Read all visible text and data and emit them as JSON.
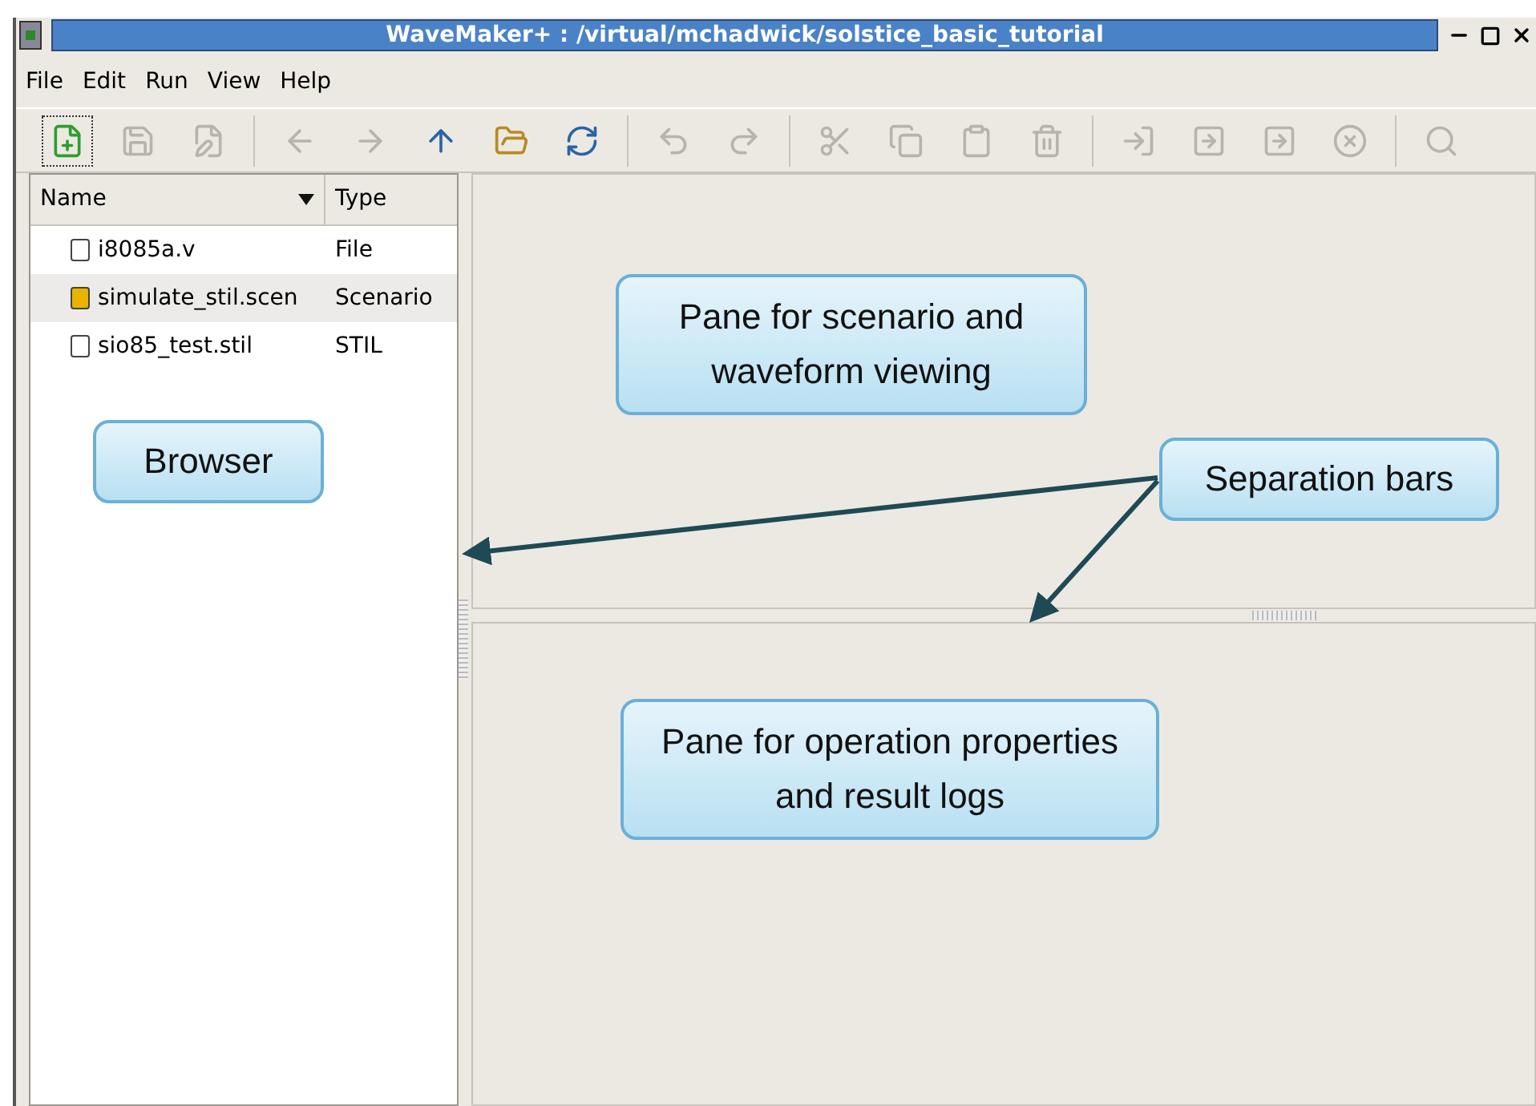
{
  "window": {
    "title": "WaveMaker+ : /virtual/mchadwick/solstice_basic_tutorial"
  },
  "menu": [
    {
      "label": "File"
    },
    {
      "label": "Edit"
    },
    {
      "label": "Run"
    },
    {
      "label": "View"
    },
    {
      "label": "Help"
    }
  ],
  "toolbar": [
    [
      {
        "kind": "new",
        "disabled": false,
        "focused": true
      },
      {
        "kind": "save",
        "disabled": true,
        "focused": false
      },
      {
        "kind": "save-as",
        "disabled": true,
        "focused": false
      }
    ],
    [
      {
        "kind": "back",
        "disabled": true,
        "focused": false
      },
      {
        "kind": "forward",
        "disabled": true,
        "focused": false
      },
      {
        "kind": "up",
        "disabled": false,
        "focused": false
      },
      {
        "kind": "open",
        "disabled": false,
        "focused": false
      },
      {
        "kind": "refresh",
        "disabled": false,
        "focused": false
      }
    ],
    [
      {
        "kind": "undo",
        "disabled": true,
        "focused": false
      },
      {
        "kind": "redo",
        "disabled": true,
        "focused": false
      }
    ],
    [
      {
        "kind": "cut",
        "disabled": true,
        "focused": false
      },
      {
        "kind": "copy",
        "disabled": true,
        "focused": false
      },
      {
        "kind": "paste",
        "disabled": true,
        "focused": false
      },
      {
        "kind": "delete",
        "disabled": true,
        "focused": false
      }
    ],
    [
      {
        "kind": "import",
        "disabled": true,
        "focused": false
      },
      {
        "kind": "export",
        "disabled": true,
        "focused": false
      },
      {
        "kind": "step",
        "disabled": true,
        "focused": false
      },
      {
        "kind": "stop",
        "disabled": true,
        "focused": false
      }
    ],
    [
      {
        "kind": "find",
        "disabled": true,
        "focused": false
      }
    ]
  ],
  "browser": {
    "columns": [
      "Name",
      "Type"
    ],
    "rows": [
      {
        "name": "i8085a.v",
        "type": "File",
        "kind": "file",
        "selected": false
      },
      {
        "name": "simulate_stil.scen",
        "type": "Scenario",
        "kind": "scenario",
        "selected": true
      },
      {
        "name": "sio85_test.stil",
        "type": "STIL",
        "kind": "file",
        "selected": false
      }
    ]
  },
  "annotations": [
    {
      "text": "Pane for scenario and waveform viewing"
    },
    {
      "text": "Browser"
    },
    {
      "text": "Separation bars"
    },
    {
      "text": "Pane for operation properties and result logs"
    }
  ]
}
